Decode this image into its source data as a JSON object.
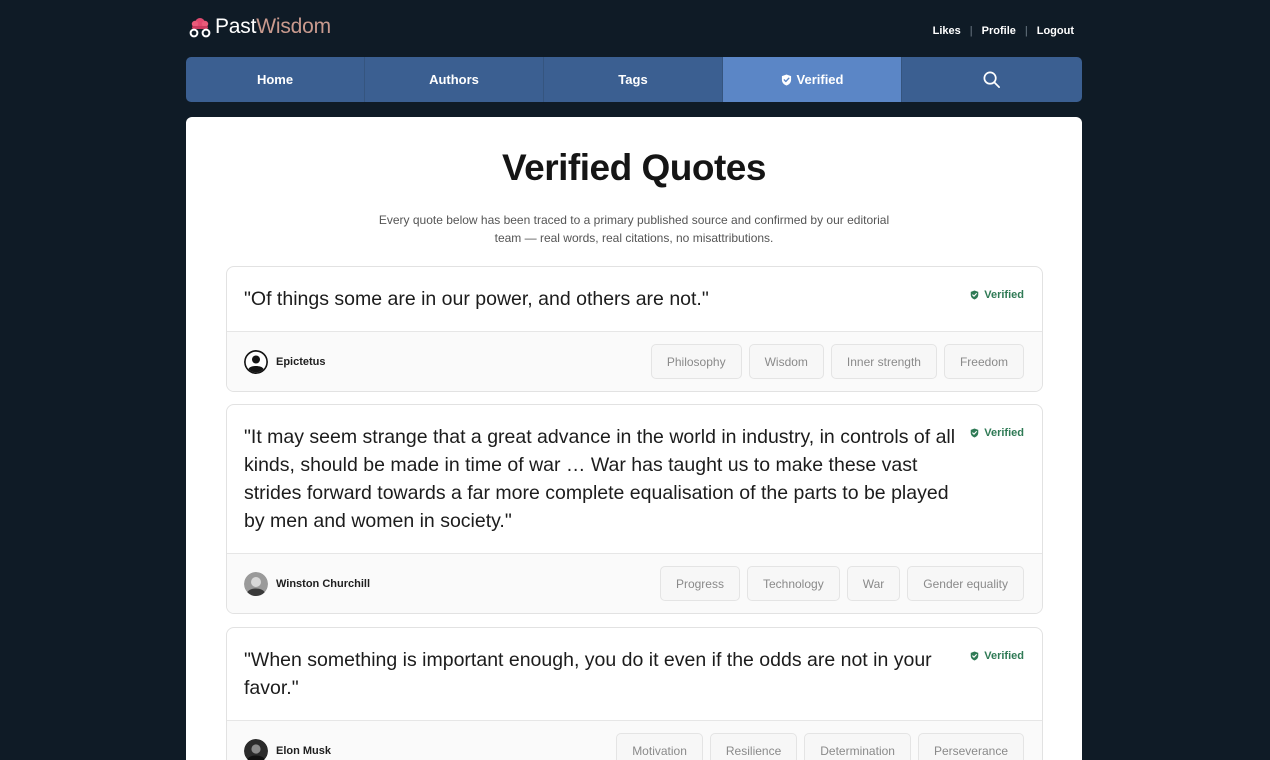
{
  "header": {
    "logo_past": "Past",
    "logo_wisdom": "Wisdom",
    "user_links": [
      "Likes",
      "Profile",
      "Logout"
    ]
  },
  "nav": {
    "items": [
      "Home",
      "Authors",
      "Tags",
      "Verified"
    ],
    "active": "Verified",
    "search_icon": "search-icon"
  },
  "page": {
    "title": "Verified Quotes",
    "subtitle": "Every quote below has been traced to a primary published source and confirmed by our editorial team — real words, real citations, no misattributions."
  },
  "quotes": [
    {
      "text": "\"Of things some are in our power, and others are not.\"",
      "badge": "Verified",
      "author": "Epictetus",
      "tags": [
        "Philosophy",
        "Wisdom",
        "Inner strength",
        "Freedom"
      ]
    },
    {
      "text": "\"It may seem strange that a great advance in the world in industry, in controls of all kinds, should be made in time of war … War has taught us to make these vast strides forward towards a far more complete equalisation of the parts to be played by men and women in society.\"",
      "badge": "Verified",
      "author": "Winston Churchill",
      "tags": [
        "Progress",
        "Technology",
        "War",
        "Gender equality"
      ]
    },
    {
      "text": "\"When something is important enough, you do it even if the odds are not in your favor.\"",
      "badge": "Verified",
      "author": "Elon Musk",
      "tags": [
        "Motivation",
        "Resilience",
        "Determination",
        "Perseverance"
      ]
    }
  ],
  "colors": {
    "background": "#0f1b26",
    "nav": "#3b5f91",
    "nav_active": "#5b86c6",
    "verified": "#2f7a55",
    "logo_accent": "#c99a8e"
  }
}
